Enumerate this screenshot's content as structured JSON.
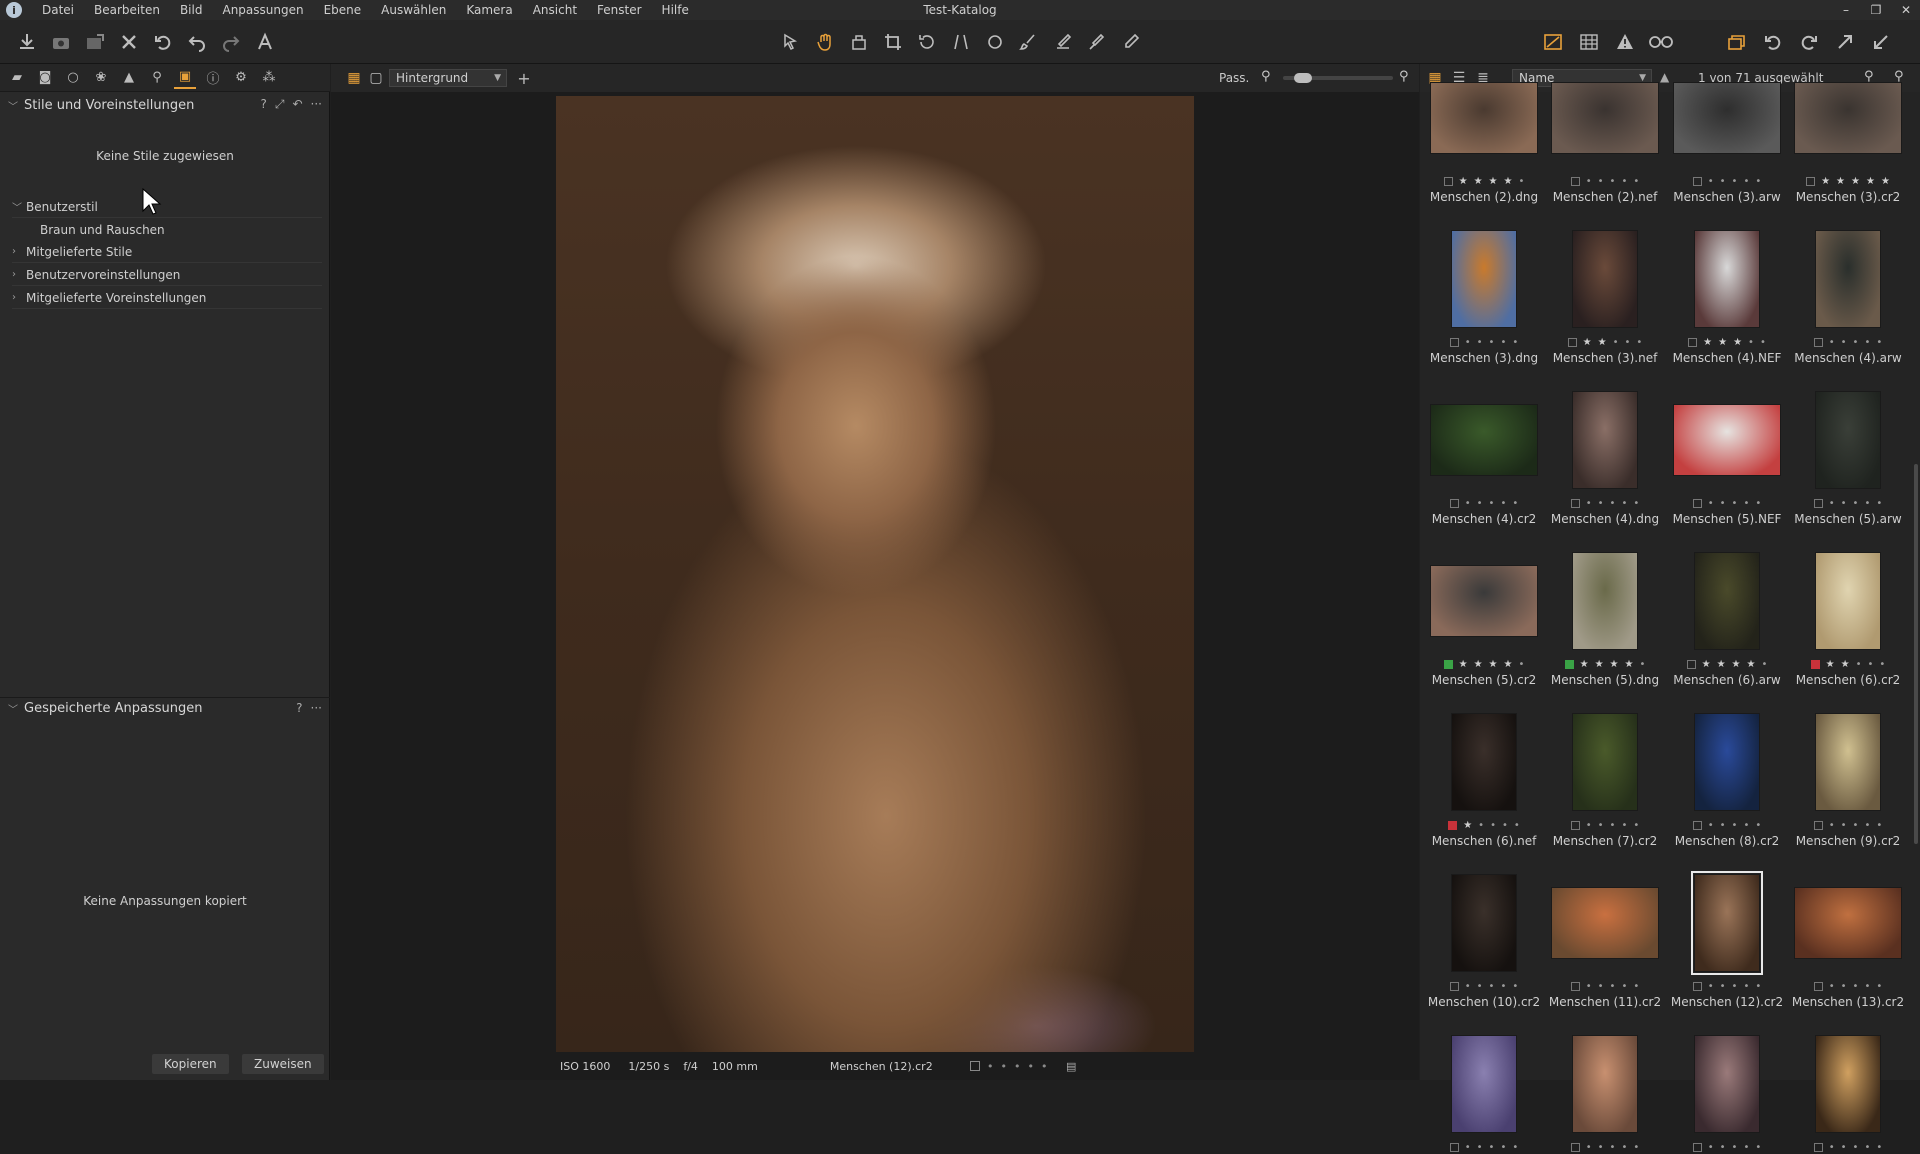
{
  "app": {
    "title": "Test-Katalog",
    "icon_letter": "i"
  },
  "menu": [
    "Datei",
    "Bearbeiten",
    "Bild",
    "Anpassungen",
    "Ebene",
    "Auswählen",
    "Kamera",
    "Ansicht",
    "Fenster",
    "Hilfe"
  ],
  "window_controls": {
    "minimize": "–",
    "restore": "❐",
    "close": "✕"
  },
  "colors": {
    "accent": "#e8a13a",
    "flag_green": "#3aa346",
    "flag_red": "#c8323a"
  },
  "left_panel": {
    "styles_title": "Stile und Voreinstellungen",
    "no_styles": "Keine Stile zugewiesen",
    "tree": [
      {
        "label": "Benutzerstil",
        "expanded": true,
        "children": [
          "Braun und Rauschen"
        ]
      },
      {
        "label": "Mitgelieferte Stile",
        "expanded": false
      },
      {
        "label": "Benutzervoreinstellungen",
        "expanded": false
      },
      {
        "label": "Mitgelieferte Voreinstellungen",
        "expanded": false
      }
    ],
    "saved_title": "Gespeicherte Anpassungen",
    "no_adjustments": "Keine Anpassungen kopiert",
    "copy_button": "Kopieren",
    "assign_button": "Zuweisen",
    "help": "?",
    "more": "···"
  },
  "viewer": {
    "layer": "Hintergrund",
    "fit_label": "Pass.",
    "zoom_fraction": 0.12,
    "status": {
      "iso": "ISO 1600",
      "shutter": "1/250 s",
      "aperture": "f/4",
      "focal": "100 mm",
      "filename": "Menschen (12).cr2"
    }
  },
  "browser": {
    "sort_by": "Name",
    "selection": "1 von 71 ausgewählt",
    "thumbnails": [
      {
        "name": "Menschen (2).dng",
        "stars": 4,
        "flag": "none",
        "colors": [
          "#4a3a30",
          "#8a6a55"
        ],
        "orient": "land"
      },
      {
        "name": "Menschen (2).nef",
        "stars": 0,
        "flag": "none",
        "colors": [
          "#3a3330",
          "#6b5a50"
        ],
        "orient": "land"
      },
      {
        "name": "Menschen (3).arw",
        "stars": 0,
        "flag": "none",
        "colors": [
          "#2e2e2e",
          "#5a5a5a"
        ],
        "orient": "land"
      },
      {
        "name": "Menschen (3).cr2",
        "stars": 5,
        "flag": "none",
        "colors": [
          "#3a3430",
          "#6a5a50"
        ],
        "orient": "land"
      },
      {
        "name": "Menschen (3).dng",
        "stars": 0,
        "flag": "none",
        "colors": [
          "#c97a2c",
          "#4f6ea3"
        ],
        "orient": "port"
      },
      {
        "name": "Menschen (3).nef",
        "stars": 2,
        "flag": "none",
        "colors": [
          "#6a4a3a",
          "#2a2020"
        ],
        "orient": "port"
      },
      {
        "name": "Menschen (4).NEF",
        "stars": 3,
        "flag": "none",
        "colors": [
          "#d8d8d8",
          "#5a3a3a"
        ],
        "orient": "port"
      },
      {
        "name": "Menschen (4).arw",
        "stars": 0,
        "flag": "none",
        "colors": [
          "#2a2f2c",
          "#6a5a4a"
        ],
        "orient": "port"
      },
      {
        "name": "Menschen (4).cr2",
        "stars": 0,
        "flag": "none",
        "colors": [
          "#3a5a2a",
          "#1c2a18"
        ],
        "orient": "land"
      },
      {
        "name": "Menschen (4).dng",
        "stars": 0,
        "flag": "none",
        "colors": [
          "#8a6f66",
          "#3a2d2a"
        ],
        "orient": "port"
      },
      {
        "name": "Menschen (5).NEF",
        "stars": 0,
        "flag": "none",
        "colors": [
          "#e6e3e0",
          "#c44040"
        ],
        "orient": "land"
      },
      {
        "name": "Menschen (5).arw",
        "stars": 0,
        "flag": "none",
        "colors": [
          "#3a3f38",
          "#1f231f"
        ],
        "orient": "port"
      },
      {
        "name": "Menschen (5).cr2",
        "stars": 4,
        "flag": "green",
        "colors": [
          "#3a3a3a",
          "#8a6a5a"
        ],
        "orient": "land"
      },
      {
        "name": "Menschen (5).dng",
        "stars": 4,
        "flag": "green",
        "colors": [
          "#6a6a4a",
          "#a09a88"
        ],
        "orient": "port"
      },
      {
        "name": "Menschen (6).arw",
        "stars": 4,
        "flag": "none",
        "colors": [
          "#4a4a2a",
          "#23231a"
        ],
        "orient": "port"
      },
      {
        "name": "Menschen (6).cr2",
        "stars": 2,
        "flag": "red",
        "colors": [
          "#e0d4b0",
          "#b09a70"
        ],
        "orient": "port"
      },
      {
        "name": "Menschen (6).nef",
        "stars": 1,
        "flag": "red",
        "colors": [
          "#3a2f2a",
          "#15110f"
        ],
        "orient": "port"
      },
      {
        "name": "Menschen (7).cr2",
        "stars": 0,
        "flag": "none",
        "colors": [
          "#4a5a2a",
          "#26301a"
        ],
        "orient": "port"
      },
      {
        "name": "Menschen (8).cr2",
        "stars": 0,
        "flag": "none",
        "colors": [
          "#2a4a9a",
          "#14233f"
        ],
        "orient": "port"
      },
      {
        "name": "Menschen (9).cr2",
        "stars": 0,
        "flag": "none",
        "colors": [
          "#d0c090",
          "#6a5a40"
        ],
        "orient": "port"
      },
      {
        "name": "Menschen (10).cr2",
        "stars": 0,
        "flag": "none",
        "colors": [
          "#3a302a",
          "#15110f"
        ],
        "orient": "port"
      },
      {
        "name": "Menschen (11).cr2",
        "stars": 0,
        "flag": "none",
        "colors": [
          "#c97040",
          "#6a4a30"
        ],
        "orient": "land"
      },
      {
        "name": "Menschen (12).cr2",
        "stars": 0,
        "flag": "none",
        "colors": [
          "#9a7458",
          "#3f2b1d"
        ],
        "orient": "port",
        "selected": true
      },
      {
        "name": "Menschen (13).cr2",
        "stars": 0,
        "flag": "none",
        "colors": [
          "#c07040",
          "#5a3020"
        ],
        "orient": "land"
      },
      {
        "name": "",
        "stars": 0,
        "flag": "none",
        "colors": [
          "#8a80b0",
          "#4a4070"
        ],
        "orient": "port"
      },
      {
        "name": "",
        "stars": 0,
        "flag": "none",
        "colors": [
          "#c89070",
          "#6a4a3a"
        ],
        "orient": "port"
      },
      {
        "name": "",
        "stars": 0,
        "flag": "none",
        "colors": [
          "#9a7a7a",
          "#3a2a2f"
        ],
        "orient": "port"
      },
      {
        "name": "",
        "stars": 0,
        "flag": "none",
        "colors": [
          "#d0a060",
          "#3a2818"
        ],
        "orient": "port"
      }
    ]
  }
}
